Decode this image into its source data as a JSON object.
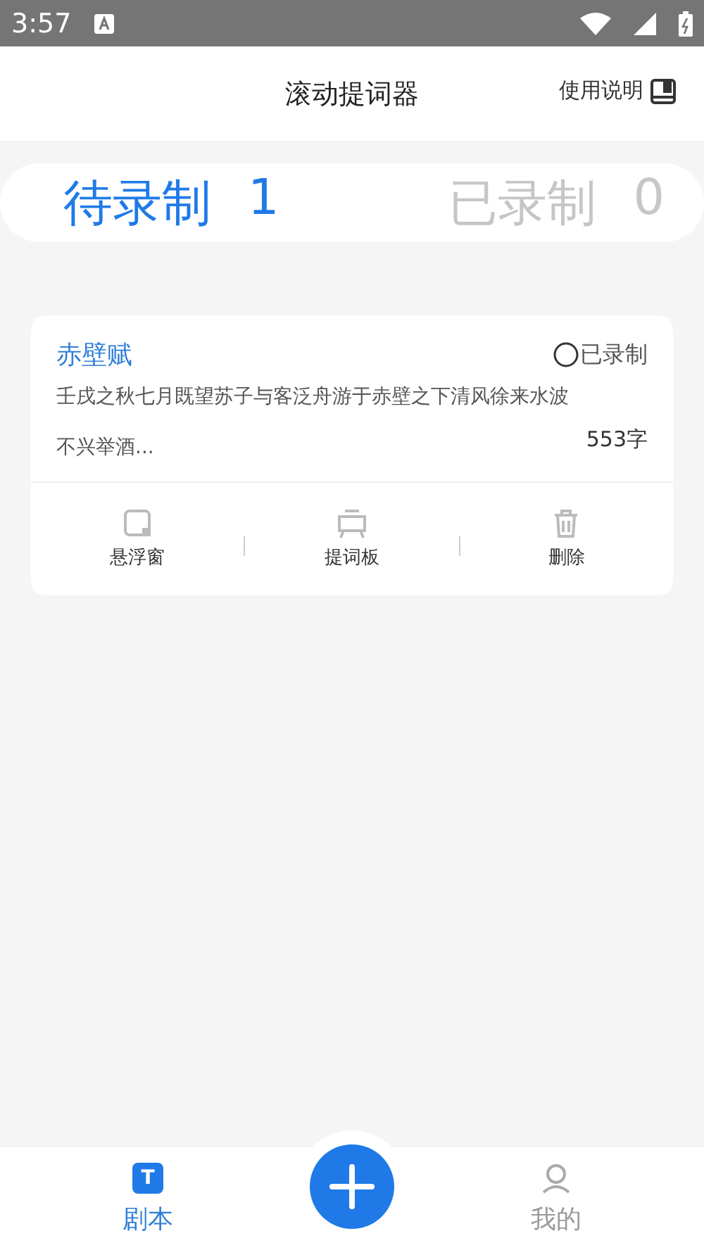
{
  "status_bar": {
    "time": "3:57"
  },
  "header": {
    "title": "滚动提词器",
    "help": "使用说明"
  },
  "tabs": [
    {
      "label": "待录制",
      "count": "1",
      "selected": true
    },
    {
      "label": "已录制",
      "count": "0",
      "selected": false
    }
  ],
  "scripts": [
    {
      "title": "赤壁赋",
      "recorded_label": "已录制",
      "recorded": false,
      "preview": "壬戌之秋七月既望苏子与客泛舟游于赤壁之下清风徐来水波不兴举酒...",
      "word_count": "553字",
      "actions": [
        {
          "kind": "float",
          "label": "悬浮窗"
        },
        {
          "kind": "board",
          "label": "提词板"
        },
        {
          "kind": "delete",
          "label": "删除"
        }
      ]
    }
  ],
  "bottom_nav": [
    {
      "kind": "script",
      "label": "剧本",
      "icon_letter": "T",
      "selected": true
    },
    {
      "kind": "mine",
      "label": "我的",
      "selected": false
    }
  ]
}
